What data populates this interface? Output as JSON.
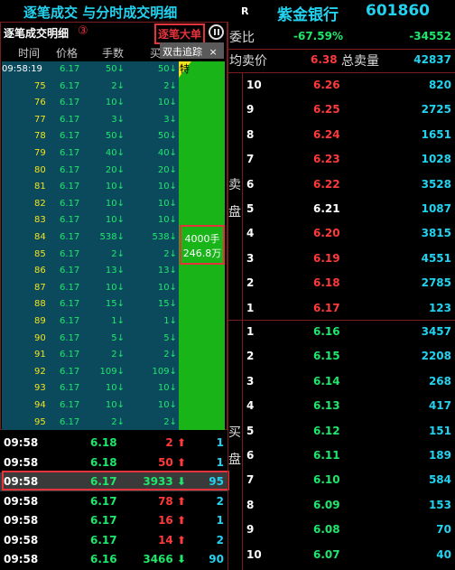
{
  "header": {
    "left_title": "逐笔成交 与分时成交明细",
    "r_label": "R",
    "stock_name": "紫金银行",
    "stock_code": "601860"
  },
  "detail_panel": {
    "title": "逐笔成交明细",
    "info_icon": "③",
    "big_order_tab": "逐笔大单",
    "pause_icon": "pause-icon",
    "tooltip": "双击追踪",
    "tooltip_close": "×",
    "columns": [
      "时间",
      "价格",
      "手数",
      "买"
    ],
    "start_time": "09:58:19",
    "rows": [
      {
        "t": "09:58:19",
        "p": "6.17",
        "v": "50",
        "v2": "50"
      },
      {
        "t": "75",
        "p": "6.17",
        "v": "2",
        "v2": "2"
      },
      {
        "t": "76",
        "p": "6.17",
        "v": "10",
        "v2": "10"
      },
      {
        "t": "77",
        "p": "6.17",
        "v": "3",
        "v2": "3"
      },
      {
        "t": "78",
        "p": "6.17",
        "v": "50",
        "v2": "50"
      },
      {
        "t": "79",
        "p": "6.17",
        "v": "40",
        "v2": "40"
      },
      {
        "t": "80",
        "p": "6.17",
        "v": "20",
        "v2": "20"
      },
      {
        "t": "81",
        "p": "6.17",
        "v": "10",
        "v2": "10"
      },
      {
        "t": "82",
        "p": "6.17",
        "v": "10",
        "v2": "10"
      },
      {
        "t": "83",
        "p": "6.17",
        "v": "10",
        "v2": "10"
      },
      {
        "t": "84",
        "p": "6.17",
        "v": "538",
        "v2": "538"
      },
      {
        "t": "85",
        "p": "6.17",
        "v": "2",
        "v2": "2"
      },
      {
        "t": "86",
        "p": "6.17",
        "v": "13",
        "v2": "13"
      },
      {
        "t": "87",
        "p": "6.17",
        "v": "10",
        "v2": "10"
      },
      {
        "t": "88",
        "p": "6.17",
        "v": "15",
        "v2": "15"
      },
      {
        "t": "89",
        "p": "6.17",
        "v": "1",
        "v2": "1"
      },
      {
        "t": "90",
        "p": "6.17",
        "v": "5",
        "v2": "5"
      },
      {
        "t": "91",
        "p": "6.17",
        "v": "2",
        "v2": "2"
      },
      {
        "t": "92",
        "p": "6.17",
        "v": "109",
        "v2": "109"
      },
      {
        "t": "93",
        "p": "6.17",
        "v": "10",
        "v2": "10"
      },
      {
        "t": "94",
        "p": "6.17",
        "v": "10",
        "v2": "10"
      },
      {
        "t": "95",
        "p": "6.17",
        "v": "2",
        "v2": "2"
      }
    ],
    "big_label_line1": "4000手",
    "big_label_line2": "246.8万",
    "corner_glyph": "特"
  },
  "minute_detail": {
    "rows": [
      {
        "time": "09:58",
        "price": "6.18",
        "vol": "2",
        "dir": "up",
        "cnt": "1"
      },
      {
        "time": "09:58",
        "price": "6.18",
        "vol": "50",
        "dir": "up",
        "cnt": "1"
      },
      {
        "time": "09:58",
        "price": "6.17",
        "vol": "3933",
        "dir": "down",
        "cnt": "95"
      },
      {
        "time": "09:58",
        "price": "6.17",
        "vol": "78",
        "dir": "up",
        "cnt": "2"
      },
      {
        "time": "09:58",
        "price": "6.17",
        "vol": "16",
        "dir": "up",
        "cnt": "1"
      },
      {
        "time": "09:58",
        "price": "6.17",
        "vol": "14",
        "dir": "up",
        "cnt": "2"
      },
      {
        "time": "09:58",
        "price": "6.16",
        "vol": "3466",
        "dir": "down",
        "cnt": "90"
      }
    ]
  },
  "quote": {
    "weibi_label": "委比",
    "weibi_pct": "-67.59%",
    "weibi_val": "-34552",
    "avg_label": "均卖价",
    "avg_price": "6.38",
    "total_label": "总卖量",
    "total_vol": "42837",
    "sell_label_1": "卖",
    "sell_label_2": "盘",
    "buy_label_1": "买",
    "buy_label_2": "盘",
    "sell": [
      {
        "lvl": "10",
        "price": "6.26",
        "vol": "820"
      },
      {
        "lvl": "9",
        "price": "6.25",
        "vol": "2725"
      },
      {
        "lvl": "8",
        "price": "6.24",
        "vol": "1651"
      },
      {
        "lvl": "7",
        "price": "6.23",
        "vol": "1028"
      },
      {
        "lvl": "6",
        "price": "6.22",
        "vol": "3528"
      },
      {
        "lvl": "5",
        "price": "6.21",
        "vol": "1087"
      },
      {
        "lvl": "4",
        "price": "6.20",
        "vol": "3815"
      },
      {
        "lvl": "3",
        "price": "6.19",
        "vol": "4551"
      },
      {
        "lvl": "2",
        "price": "6.18",
        "vol": "2785"
      },
      {
        "lvl": "1",
        "price": "6.17",
        "vol": "123"
      }
    ],
    "buy": [
      {
        "lvl": "1",
        "price": "6.16",
        "vol": "3457"
      },
      {
        "lvl": "2",
        "price": "6.15",
        "vol": "2208"
      },
      {
        "lvl": "3",
        "price": "6.14",
        "vol": "268"
      },
      {
        "lvl": "4",
        "price": "6.13",
        "vol": "417"
      },
      {
        "lvl": "5",
        "price": "6.12",
        "vol": "151"
      },
      {
        "lvl": "6",
        "price": "6.11",
        "vol": "189"
      },
      {
        "lvl": "7",
        "price": "6.10",
        "vol": "584"
      },
      {
        "lvl": "8",
        "price": "6.09",
        "vol": "153"
      },
      {
        "lvl": "9",
        "price": "6.08",
        "vol": "70"
      },
      {
        "lvl": "10",
        "price": "6.07",
        "vol": "40"
      }
    ]
  },
  "colors": {
    "title_cyan": "#22d3f0",
    "up_red": "#ff3a3a",
    "down_green": "#1ee86b",
    "white_price": "#ffffff",
    "highlight_border": "#e5333b",
    "green_bar": "#18b418"
  }
}
